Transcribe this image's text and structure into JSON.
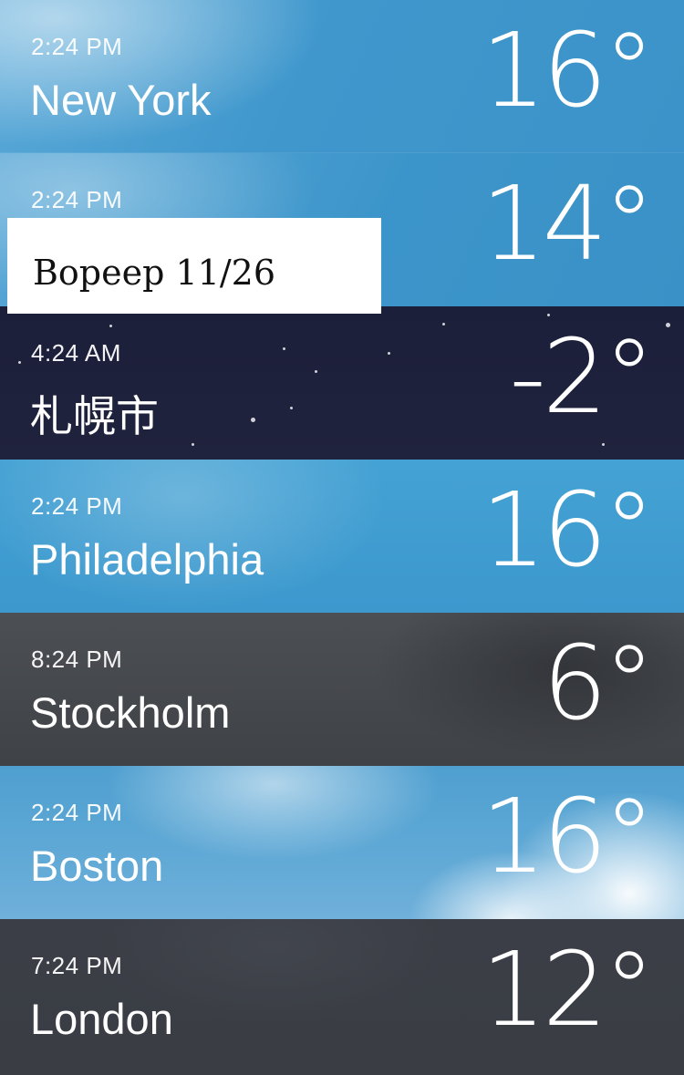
{
  "cities": [
    {
      "time": "2:24 PM",
      "city": "New York",
      "temp": "16°",
      "condition": "day-clear"
    },
    {
      "time": "2:24 PM",
      "city": "",
      "temp": "14°",
      "condition": "day-clear"
    },
    {
      "time": "4:24 AM",
      "city": "札幌市",
      "temp": "-2°",
      "condition": "night-clear"
    },
    {
      "time": "2:24 PM",
      "city": "Philadelphia",
      "temp": "16°",
      "condition": "day-clear"
    },
    {
      "time": "8:24 PM",
      "city": "Stockholm",
      "temp": "6°",
      "condition": "overcast"
    },
    {
      "time": "2:24 PM",
      "city": "Boston",
      "temp": "16°",
      "condition": "day-cloudy"
    },
    {
      "time": "7:24 PM",
      "city": "London",
      "temp": "12°",
      "condition": "overcast"
    }
  ],
  "watermark": {
    "text": "Bopeep 11/26"
  }
}
